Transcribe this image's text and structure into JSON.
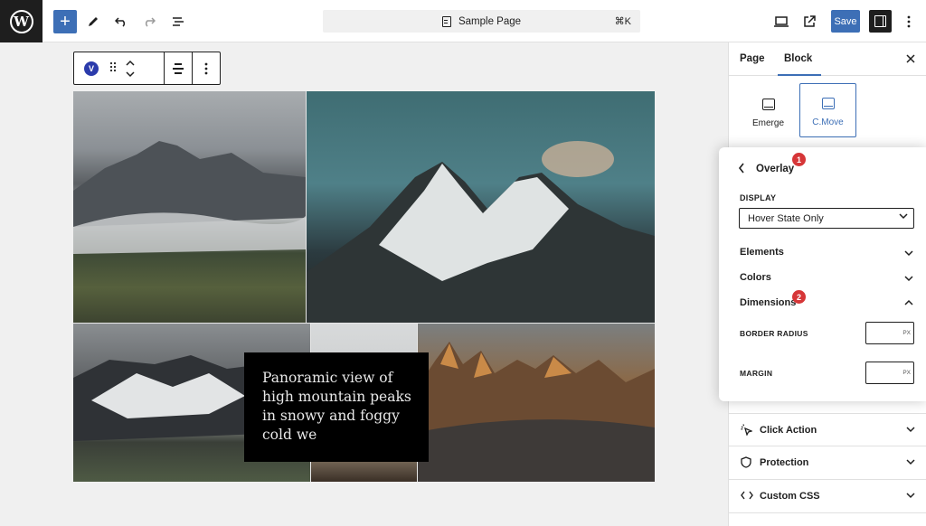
{
  "topbar": {
    "add_icon": "+",
    "document_title": "Sample Page",
    "shortcut": "⌘K",
    "save_label": "Save"
  },
  "block_toolbar": {
    "block_badge": "V"
  },
  "gallery": {
    "caption": "Panoramic view of high mountain peaks in snowy and foggy cold we"
  },
  "sidebar": {
    "tabs": [
      "Page",
      "Block"
    ],
    "active_tab": "Block",
    "style_cards": [
      {
        "label": "Emerge"
      },
      {
        "label": "C.Move"
      }
    ],
    "selected_style": "C.Move",
    "overlay": {
      "title": "Overlay",
      "display_label": "DISPLAY",
      "display_value": "Hover State Only",
      "rows": [
        "Elements",
        "Colors",
        "Dimensions"
      ],
      "expanded_row": "Dimensions",
      "border_radius_label": "BORDER RADIUS",
      "margin_label": "MARGIN",
      "unit": "PX",
      "badges": [
        "1",
        "2"
      ]
    },
    "sections": [
      "Click Action",
      "Protection",
      "Custom CSS"
    ]
  },
  "colors": {
    "accent": "#3d6fb6",
    "badge_red": "#d63638",
    "dark": "#1e1e1e"
  }
}
